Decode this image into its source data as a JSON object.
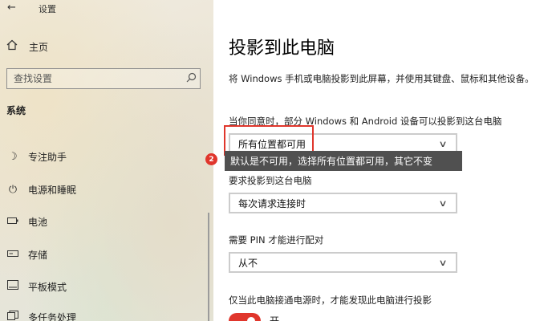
{
  "window": {
    "title": "设置",
    "back_icon": "back-arrow-icon"
  },
  "sidebar": {
    "home_label": "主页",
    "search_placeholder": "查找设置",
    "section_title": "系统",
    "items": [
      {
        "label": "专注助手",
        "icon": "moon-icon"
      },
      {
        "label": "电源和睡眠",
        "icon": "power-icon"
      },
      {
        "label": "电池",
        "icon": "battery-icon"
      },
      {
        "label": "存储",
        "icon": "storage-icon"
      },
      {
        "label": "平板模式",
        "icon": "tablet-icon"
      },
      {
        "label": "多任务处理",
        "icon": "multitask-icon"
      }
    ]
  },
  "main": {
    "title": "投影到此电脑",
    "description": "将 Windows 手机或电脑投影到此屏幕，并使用其键盘、鼠标和其他设备。",
    "setting1": {
      "label": "当你同意时，部分 Windows 和 Android 设备可以投影到这台电脑",
      "value": "所有位置都可用"
    },
    "annotation": {
      "badge": "2",
      "tooltip": "默认是不可用，选择所有位置都可用，其它不变"
    },
    "setting2": {
      "label": "要求投影到这台电脑",
      "value": "每次请求连接时"
    },
    "setting3": {
      "label": "需要 PIN 才能进行配对",
      "value": "从不"
    },
    "setting4": {
      "label": "仅当此电脑接通电源时，才能发现此电脑进行投影",
      "toggle_label": "开"
    }
  },
  "colors": {
    "accent": "#e0362c",
    "tooltip_bg": "#505050"
  }
}
